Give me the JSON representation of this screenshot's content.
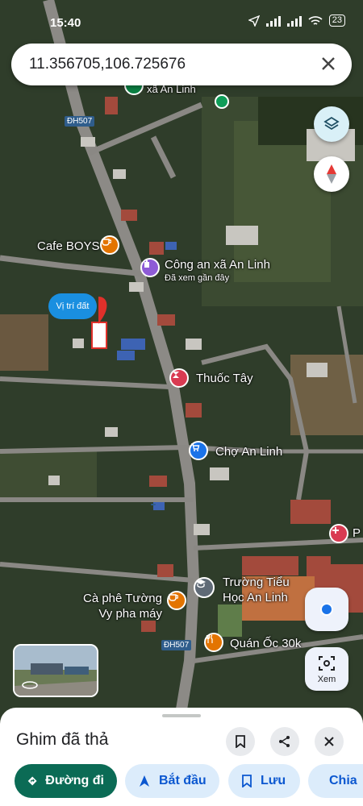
{
  "status_bar": {
    "time": "15:40",
    "battery": "23"
  },
  "search": {
    "value": "11.356705,106.725676"
  },
  "map": {
    "place_labels": [
      {
        "key": "xa_an_linh",
        "text": "xã An Linh"
      },
      {
        "key": "cafe_boys",
        "text": "Cafe BOYS"
      },
      {
        "key": "cong_an",
        "text": "Công an xã An Linh"
      },
      {
        "key": "cong_an_sub",
        "text": "Đã xem gần đây"
      },
      {
        "key": "thuoc_tay",
        "text": "Thuốc Tây"
      },
      {
        "key": "cho_an_linh",
        "text": "Chợ An Linh"
      },
      {
        "key": "truong",
        "text": "Trường Tiểu\nHọc An Linh"
      },
      {
        "key": "ca_phe",
        "text": "Cà phê Tường\nVy pha máy"
      },
      {
        "key": "quan_oc",
        "text": "Quán Ốc 30k"
      },
      {
        "key": "p_edge",
        "text": "P"
      }
    ],
    "road_tags": [
      "ĐH507",
      "ĐH507"
    ],
    "pin_bubble": "Vị trí đất"
  },
  "controls": {
    "xem_label": "Xem"
  },
  "sheet": {
    "title": "Ghim đã thả",
    "actions": [
      {
        "key": "directions",
        "label": "Đường đi"
      },
      {
        "key": "start",
        "label": "Bắt đầu"
      },
      {
        "key": "save",
        "label": "Lưu"
      },
      {
        "key": "share",
        "label": "Chia"
      }
    ]
  },
  "colors": {
    "primary_green": "#0b6b55",
    "accent_blue": "#0b57d0",
    "pill_bg": "#dcecfb"
  }
}
